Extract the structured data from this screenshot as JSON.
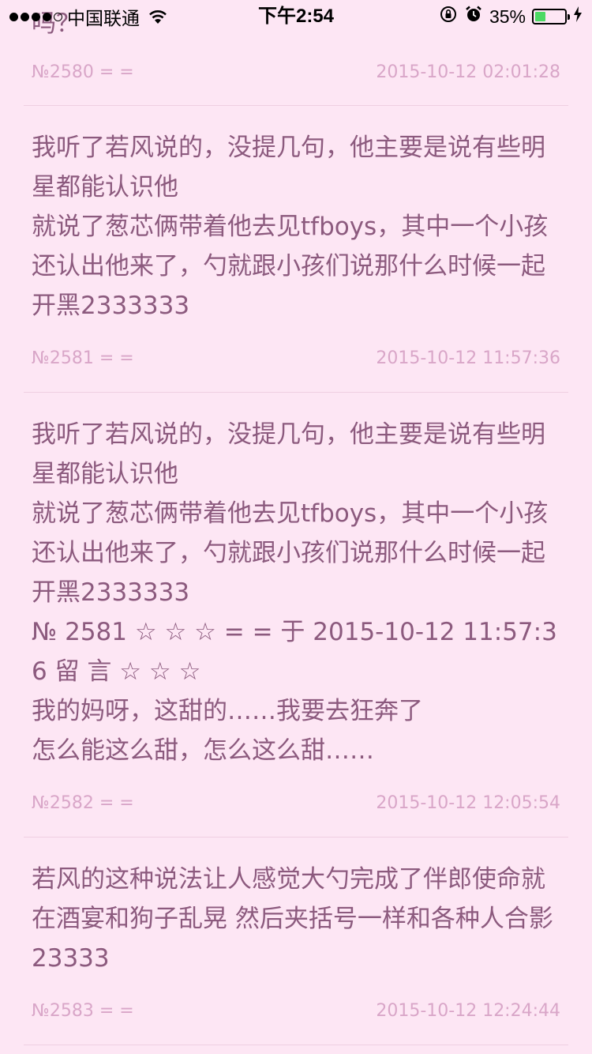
{
  "status_bar": {
    "carrier": "中国联通",
    "time": "下午2:54",
    "battery_percent": "35%",
    "battery_level": 0.35
  },
  "posts": [
    {
      "text": "吗？",
      "number": "№2580 = =",
      "timestamp": "2015-10-12 02:01:28"
    },
    {
      "text": "我听了若风说的，没提几句，他主要是说有些明星都能认识他\n就说了葱芯俩带着他去见tfboys，其中一个小孩还认出他来了，勺就跟小孩们说那什么时候一起开黑2333333",
      "number": "№2581 = =",
      "timestamp": "2015-10-12 11:57:36"
    },
    {
      "text": "我听了若风说的，没提几句，他主要是说有些明星都能认识他\n就说了葱芯俩带着他去见tfboys，其中一个小孩还认出他来了，勺就跟小孩们说那什么时候一起开黑2333333\n№ 2581 ☆ ☆ ☆ = = 于 2015-10-12 11:57:36 留 言 ☆ ☆ ☆\n我的妈呀，这甜的……我要去狂奔了\n怎么能这么甜，怎么这么甜……",
      "number": "№2582 = =",
      "timestamp": "2015-10-12 12:05:54"
    },
    {
      "text": "若风的这种说法让人感觉大勺完成了伴郎使命就在酒宴和狗子乱晃 然后夹括号一样和各种人合影 23333",
      "number": "№2583 = =",
      "timestamp": "2015-10-12 12:24:44"
    }
  ]
}
